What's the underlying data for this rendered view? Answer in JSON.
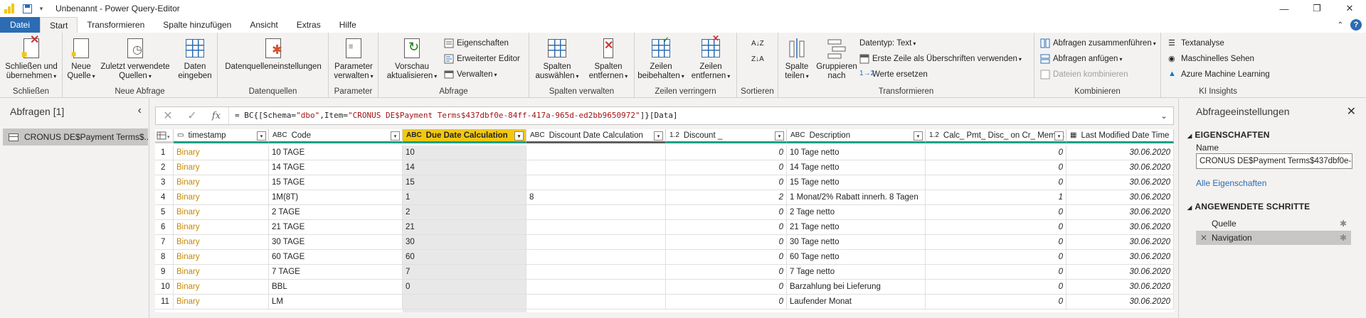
{
  "window": {
    "title": "Unbenannt - Power Query-Editor",
    "controls": [
      "—",
      "❐",
      "✕"
    ]
  },
  "tabs": [
    {
      "label": "Datei"
    },
    {
      "label": "Start"
    },
    {
      "label": "Transformieren"
    },
    {
      "label": "Spalte hinzufügen"
    },
    {
      "label": "Ansicht"
    },
    {
      "label": "Extras"
    },
    {
      "label": "Hilfe"
    }
  ],
  "ribbon": {
    "groups": {
      "schliessen": "Schließen",
      "neue_abfrage": "Neue Abfrage",
      "datenquellen": "Datenquellen",
      "parameter": "Parameter",
      "abfrage": "Abfrage",
      "spalten_verwalten": "Spalten verwalten",
      "zeilen_verringern": "Zeilen verringern",
      "sortieren": "Sortieren",
      "transformieren": "Transformieren",
      "kombinieren": "Kombinieren",
      "ki_insights": "KI Insights"
    },
    "buttons": {
      "close_apply_1": "Schließen und",
      "close_apply_2": "übernehmen",
      "new_source_1": "Neue",
      "new_source_2": "Quelle",
      "recent_1": "Zuletzt verwendete",
      "recent_2": "Quellen",
      "enter_data_1": "Daten",
      "enter_data_2": "eingeben",
      "datasource_settings": "Datenquelleneinstellungen",
      "manage_params_1": "Parameter",
      "manage_params_2": "verwalten",
      "refresh_1": "Vorschau",
      "refresh_2": "aktualisieren",
      "properties": "Eigenschaften",
      "advanced_editor": "Erweiterter Editor",
      "manage": "Verwalten",
      "choose_cols_1": "Spalten",
      "choose_cols_2": "auswählen",
      "remove_cols_1": "Spalten",
      "remove_cols_2": "entfernen",
      "keep_rows_1": "Zeilen",
      "keep_rows_2": "beibehalten",
      "remove_rows_1": "Zeilen",
      "remove_rows_2": "entfernen",
      "split_1": "Spalte",
      "split_2": "teilen",
      "group_1": "Gruppieren",
      "group_2": "nach",
      "datatype": "Datentyp: Text",
      "first_row_header": "Erste Zeile als Überschriften verwenden",
      "replace_values": "Werte ersetzen",
      "merge_queries": "Abfragen zusammenführen",
      "append_queries": "Abfragen anfügen",
      "combine_files": "Dateien kombinieren",
      "text_analytics": "Textanalyse",
      "vision": "Maschinelles Sehen",
      "azure_ml": "Azure Machine Learning"
    }
  },
  "queries_panel": {
    "title": "Abfragen [1]",
    "items": [
      {
        "label": "CRONUS DE$Payment Terms$..."
      }
    ]
  },
  "formula": {
    "prefix": "= BC{[Schema=",
    "s1": "\"dbo\"",
    "mid": ",Item=",
    "s2": "\"CRONUS DE$Payment Terms$437dbf0e-84ff-417a-965d-ed2bb9650972\"",
    "suffix": "]}[Data]"
  },
  "grid": {
    "columns": [
      {
        "name": "timestamp",
        "type": "▭"
      },
      {
        "name": "Code",
        "type": "ABC"
      },
      {
        "name": "Due Date Calculation",
        "type": "ABC"
      },
      {
        "name": "Discount Date Calculation",
        "type": "ABC"
      },
      {
        "name": "Discount _",
        "type": "1.2"
      },
      {
        "name": "Description",
        "type": "ABC"
      },
      {
        "name": "Calc_ Pmt_ Disc_ on Cr_ Memos",
        "type": "1.2"
      },
      {
        "name": "Last Modified Date Time",
        "type": "▦"
      }
    ],
    "rows": [
      [
        "1",
        "Binary",
        "10 TAGE",
        "10",
        "",
        "0",
        "10 Tage netto",
        "0",
        "30.06.2020"
      ],
      [
        "2",
        "Binary",
        "14 TAGE",
        "14",
        "",
        "0",
        "14 Tage netto",
        "0",
        "30.06.2020"
      ],
      [
        "3",
        "Binary",
        "15 TAGE",
        "15",
        "",
        "0",
        "15 Tage netto",
        "0",
        "30.06.2020"
      ],
      [
        "4",
        "Binary",
        "1M(8T)",
        "1",
        "8",
        "2",
        "1 Monat/2% Rabatt innerh. 8 Tagen",
        "1",
        "30.06.2020"
      ],
      [
        "5",
        "Binary",
        "2 TAGE",
        "2",
        "",
        "0",
        "2 Tage netto",
        "0",
        "30.06.2020"
      ],
      [
        "6",
        "Binary",
        "21 TAGE",
        "21",
        "",
        "0",
        "21 Tage netto",
        "0",
        "30.06.2020"
      ],
      [
        "7",
        "Binary",
        "30 TAGE",
        "30",
        "",
        "0",
        "30 Tage netto",
        "0",
        "30.06.2020"
      ],
      [
        "8",
        "Binary",
        "60 TAGE",
        "60",
        "",
        "0",
        "60 Tage netto",
        "0",
        "30.06.2020"
      ],
      [
        "9",
        "Binary",
        "7 TAGE",
        "7",
        "",
        "0",
        "7 Tage netto",
        "0",
        "30.06.2020"
      ],
      [
        "10",
        "Binary",
        "BBL",
        "0",
        "",
        "0",
        "Barzahlung bei Lieferung",
        "0",
        "30.06.2020"
      ],
      [
        "11",
        "Binary",
        "LM",
        "",
        "",
        "0",
        "Laufender Monat",
        "0",
        "30.06.2020"
      ]
    ]
  },
  "settings_panel": {
    "title": "Abfrageeinstellungen",
    "properties_header": "EIGENSCHAFTEN",
    "name_label": "Name",
    "name_value": "CRONUS DE$Payment Terms$437dbf0e-",
    "all_properties": "Alle Eigenschaften",
    "steps_header": "ANGEWENDETE SCHRITTE",
    "steps": [
      {
        "label": "Quelle"
      },
      {
        "label": "Navigation"
      }
    ]
  }
}
